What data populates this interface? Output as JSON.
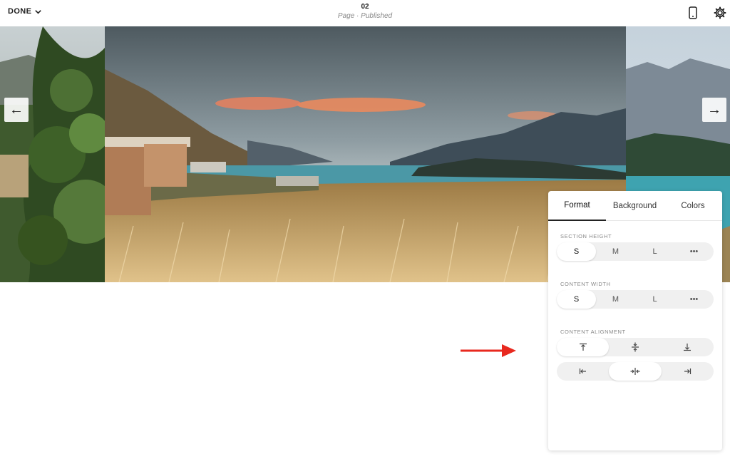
{
  "topbar": {
    "done_label": "DONE",
    "page_number": "02",
    "page_status": "Page · Published",
    "icons": [
      "mobile-preview-icon",
      "settings-gear-icon"
    ]
  },
  "gallery": {
    "prev_arrow": "←",
    "next_arrow": "→"
  },
  "panel": {
    "tabs": [
      {
        "label": "Format",
        "active": true
      },
      {
        "label": "Background",
        "active": false
      },
      {
        "label": "Colors",
        "active": false
      }
    ],
    "section_height": {
      "label": "SECTION HEIGHT",
      "options": [
        "S",
        "M",
        "L",
        "•••"
      ],
      "selected": "S"
    },
    "content_width": {
      "label": "CONTENT WIDTH",
      "options": [
        "S",
        "M",
        "L",
        "•••"
      ],
      "selected": "S"
    },
    "content_alignment": {
      "label": "CONTENT ALIGNMENT",
      "vertical_selected": "align-top",
      "horizontal_selected": "align-center"
    }
  },
  "colors": {
    "annotation_arrow": "#e8291f",
    "active_tab_underline": "#222222"
  }
}
